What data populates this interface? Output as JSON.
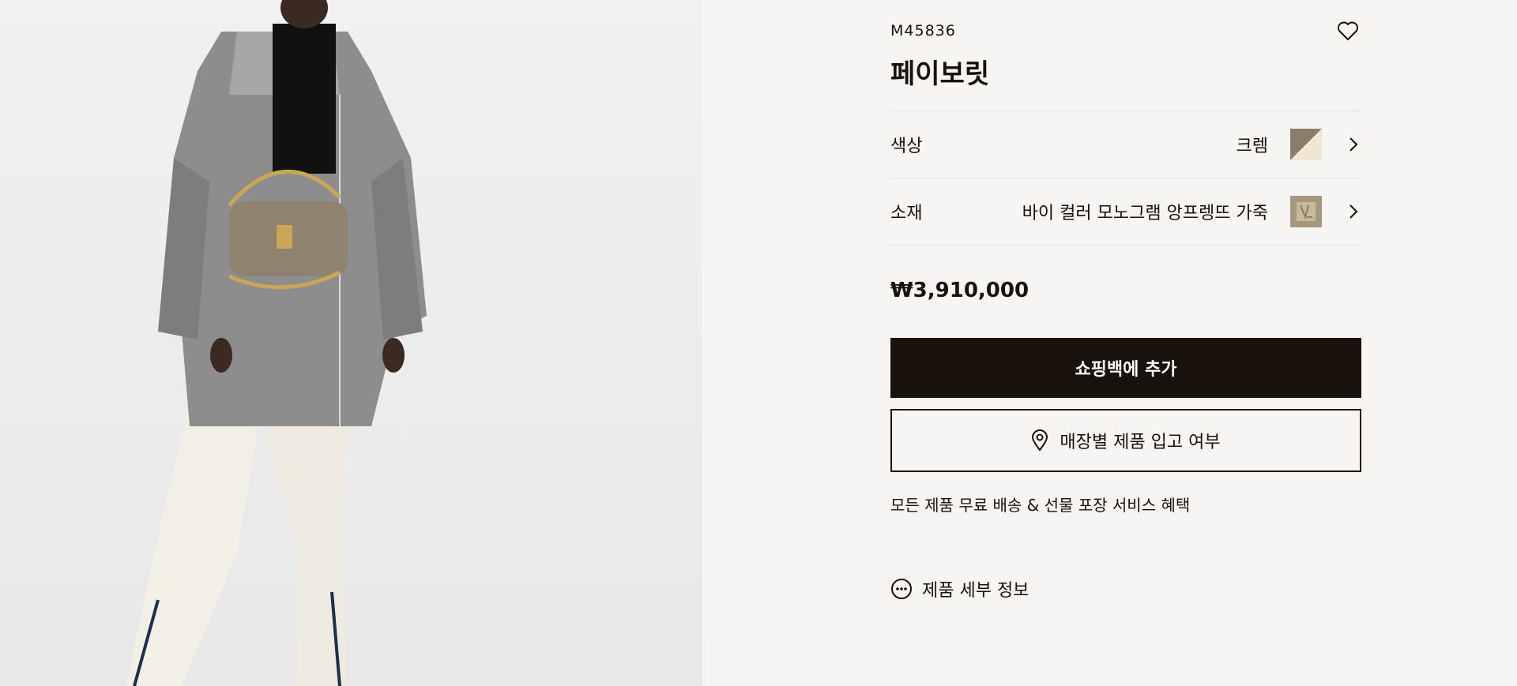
{
  "product": {
    "sku": "M45836",
    "name": "페이보릿",
    "price": "₩3,910,000"
  },
  "options": {
    "color": {
      "label": "색상",
      "value": "크렘"
    },
    "material": {
      "label": "소재",
      "value": "바이 컬러 모노그램 앙프렝뜨 가죽"
    }
  },
  "actions": {
    "add_to_bag": "쇼핑백에 추가",
    "store_availability": "매장별 제품 입고 여부"
  },
  "shipping_note": "모든 제품 무료 배송 & 선물 포장 서비스 혜택",
  "details_link": "제품 세부 정보",
  "icons": {
    "wishlist": "heart-icon",
    "chevron": "chevron-right-icon",
    "location": "location-pin-icon",
    "more": "more-dots-icon"
  },
  "colors": {
    "primary": "#19110b",
    "background": "#f6f5f3",
    "divider": "#e1dfdb"
  }
}
